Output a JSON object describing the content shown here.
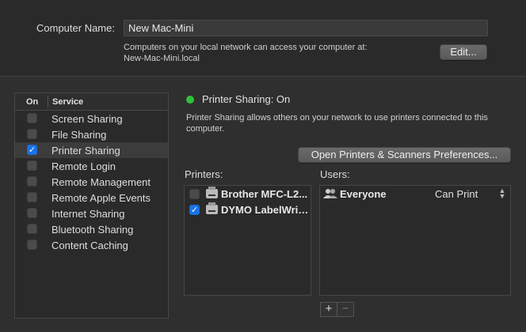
{
  "computer_name": {
    "label": "Computer Name:",
    "value": "New Mac-Mini",
    "note_line1": "Computers on your local network can access your computer at:",
    "note_line2": "New-Mac-Mini.local",
    "edit_button": "Edit..."
  },
  "services_table": {
    "col_on": "On",
    "col_service": "Service",
    "rows": [
      {
        "label": "Screen Sharing",
        "checked": false,
        "selected": false
      },
      {
        "label": "File Sharing",
        "checked": false,
        "selected": false
      },
      {
        "label": "Printer Sharing",
        "checked": true,
        "selected": true
      },
      {
        "label": "Remote Login",
        "checked": false,
        "selected": false
      },
      {
        "label": "Remote Management",
        "checked": false,
        "selected": false
      },
      {
        "label": "Remote Apple Events",
        "checked": false,
        "selected": false
      },
      {
        "label": "Internet Sharing",
        "checked": false,
        "selected": false
      },
      {
        "label": "Bluetooth Sharing",
        "checked": false,
        "selected": false
      },
      {
        "label": "Content Caching",
        "checked": false,
        "selected": false
      }
    ]
  },
  "status": {
    "text": "Printer Sharing: On",
    "color": "#2fc23a",
    "description": "Printer Sharing allows others on your network to use printers connected to this computer."
  },
  "open_prefs_button": "Open Printers & Scanners Preferences...",
  "printers": {
    "label": "Printers:",
    "items": [
      {
        "name": "Brother MFC-L2...",
        "checked": false
      },
      {
        "name": "DYMO LabelWrit...",
        "checked": true
      }
    ]
  },
  "users": {
    "label": "Users:",
    "items": [
      {
        "name": "Everyone",
        "permission": "Can Print"
      }
    ]
  },
  "buttons": {
    "add": "+",
    "remove": "−"
  },
  "colors": {
    "accent": "#1a73e8",
    "background": "#2a2a2a"
  }
}
